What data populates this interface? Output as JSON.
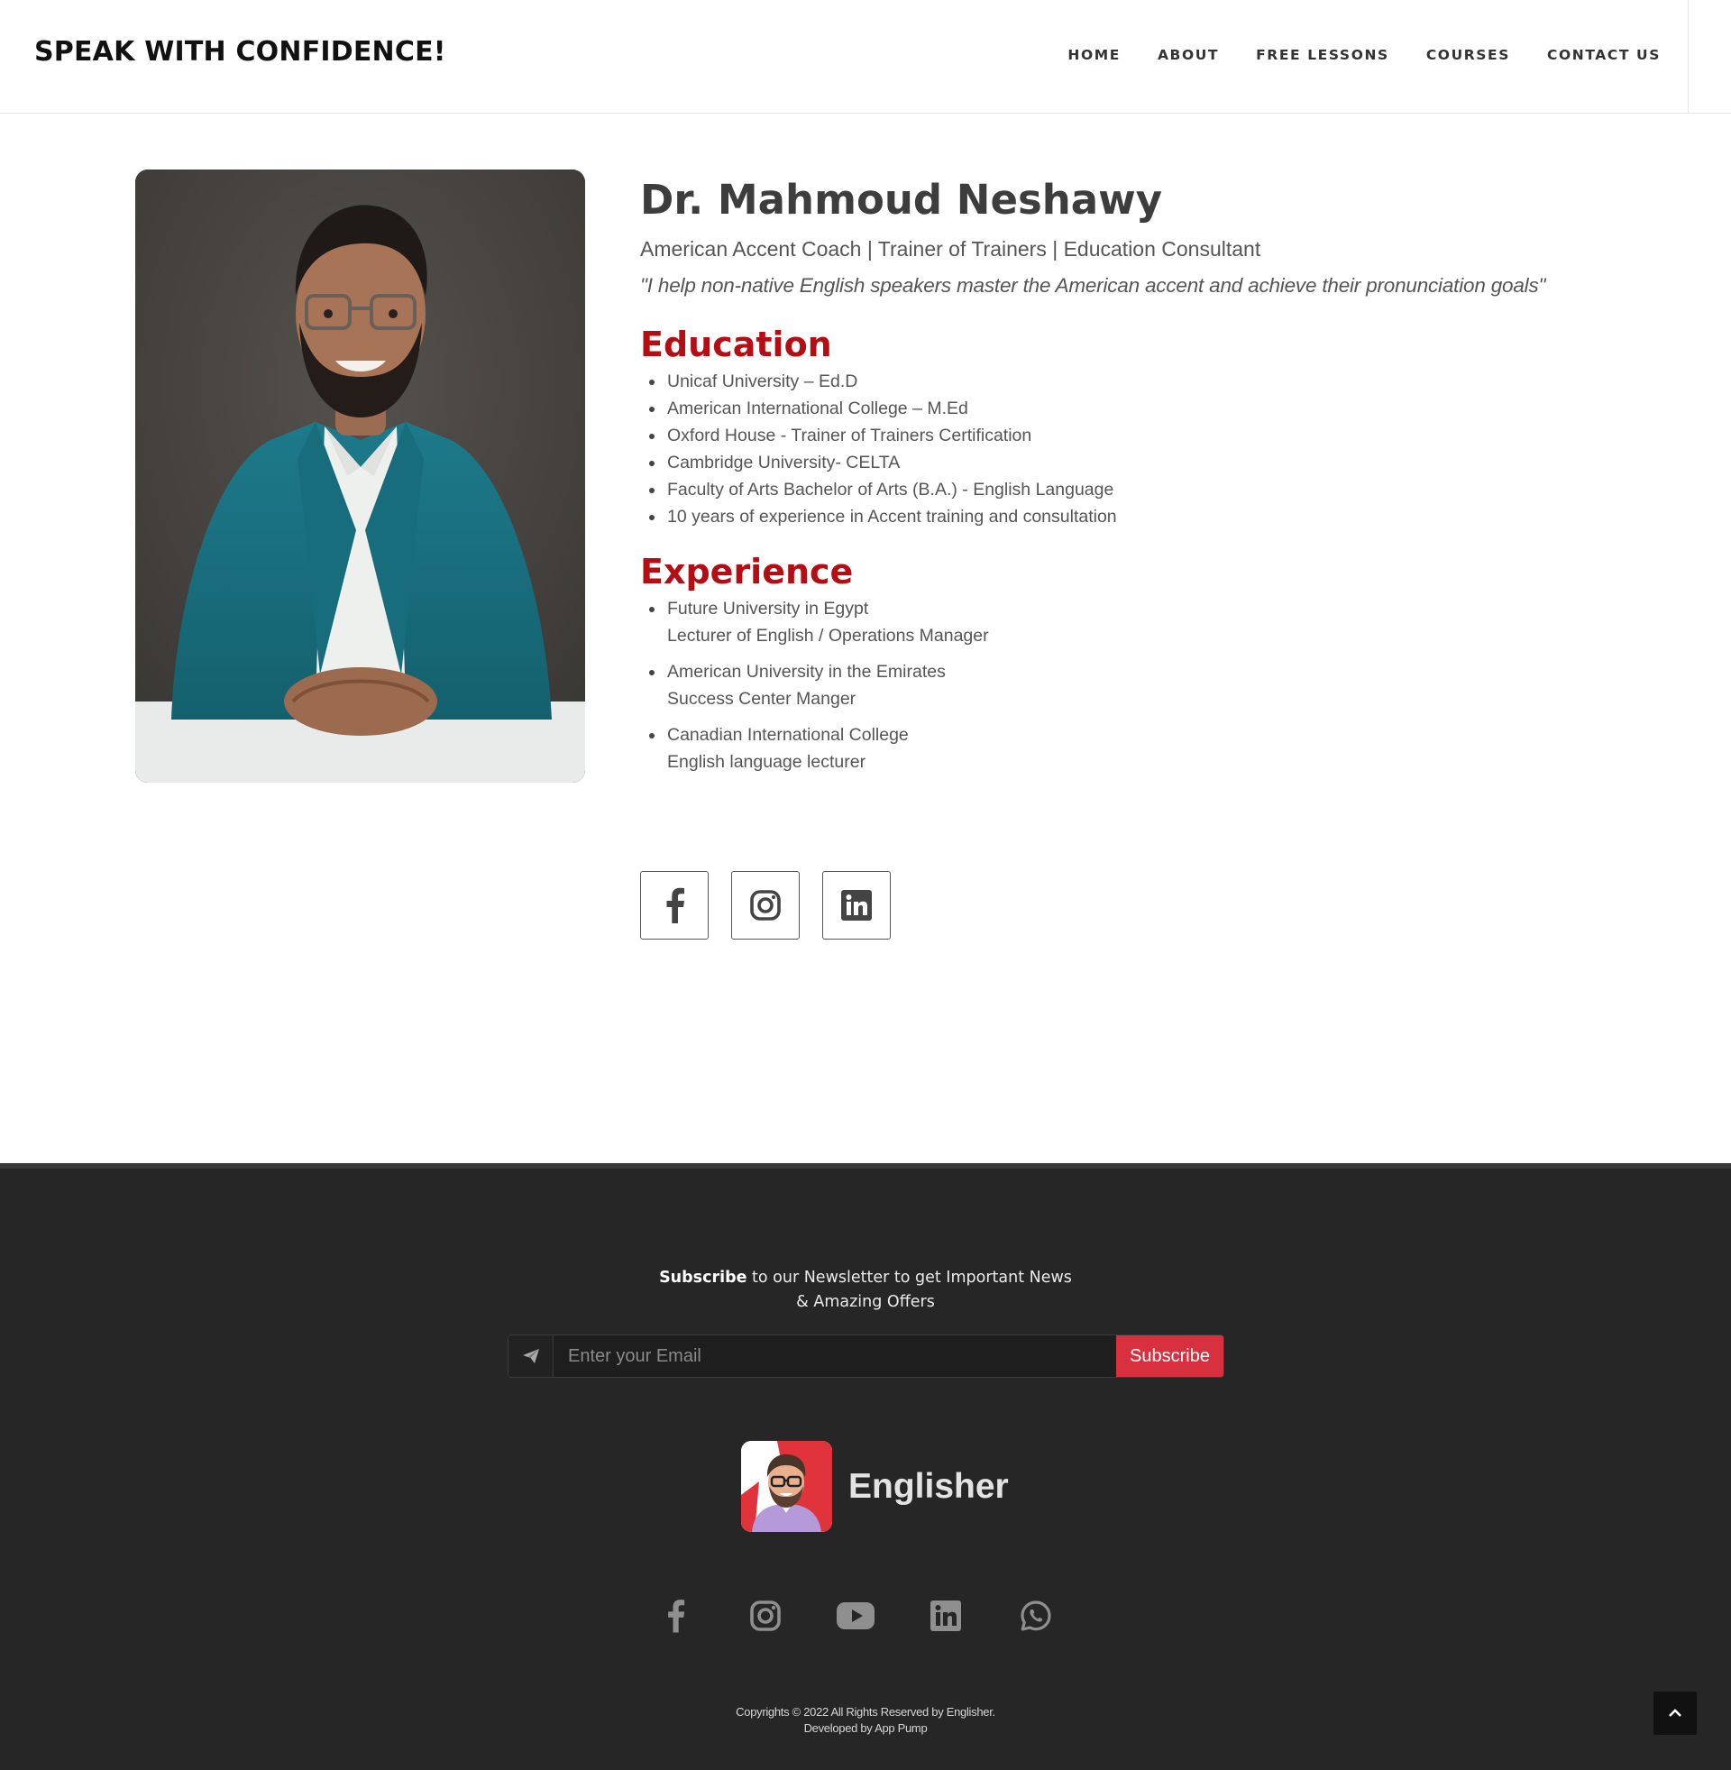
{
  "header": {
    "brand": "SPEAK WITH CONFIDENCE!",
    "nav": [
      "HOME",
      "ABOUT",
      "FREE LESSONS",
      "COURSES",
      "CONTACT US"
    ]
  },
  "profile": {
    "name": "Dr. Mahmoud Neshawy",
    "roles": "American Accent Coach | Trainer of Trainers | Education Consultant",
    "quote": "\"I help non-native English speakers master the American accent and achieve their pronunciation goals\"",
    "education_title": "Education",
    "education": [
      "Unicaf University – Ed.D",
      "American International College – M.Ed",
      "Oxford House - Trainer of Trainers Certification",
      "Cambridge University- CELTA",
      "Faculty of Arts Bachelor of Arts (B.A.) - English Language",
      "10 years of experience in Accent training and consultation"
    ],
    "experience_title": "Experience",
    "experience": [
      {
        "org": "Future University in Egypt",
        "role": "Lecturer of English / Operations Manager"
      },
      {
        "org": "American University in the Emirates",
        "role": "Success Center Manger"
      },
      {
        "org": "Canadian International College",
        "role": "English language lecturer"
      }
    ],
    "social_icons": [
      "facebook-icon",
      "instagram-icon",
      "linkedin-icon"
    ]
  },
  "footer": {
    "newsletter_strong": "Subscribe",
    "newsletter_line1": " to our Newsletter to get Important News",
    "newsletter_line2": "& Amazing Offers",
    "email_placeholder": "Enter your Email",
    "subscribe_label": "Subscribe",
    "logo_text": "Englisher",
    "social_icons": [
      "facebook-icon",
      "instagram-icon",
      "youtube-icon",
      "linkedin-icon",
      "whatsapp-icon"
    ],
    "copyright_line1": "Copyrights © 2022 All Rights Reserved by Englisher.",
    "copyright_line2": "Developed by App Pump"
  },
  "colors": {
    "accent_red": "#b40d14",
    "subscribe_button": "#d9303f",
    "footer_bg": "#262626"
  }
}
